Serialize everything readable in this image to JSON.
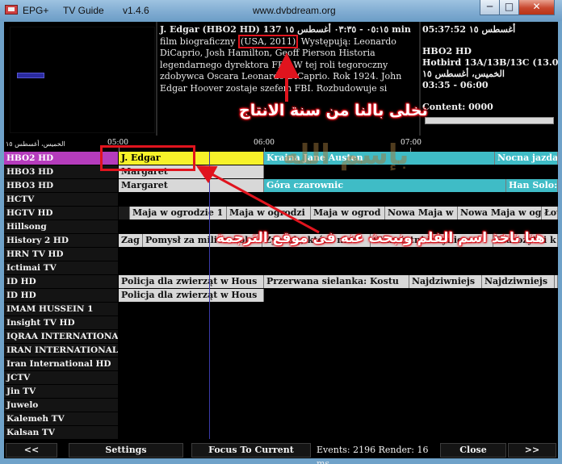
{
  "window": {
    "app_name": "EPG+",
    "menu": "TV Guide",
    "version": "v1.4.6",
    "site": "www.dvbdream.org",
    "buttons": {
      "minimize": "─",
      "maximize": "□",
      "close": "✕"
    }
  },
  "description": {
    "title_line": "J. Edgar  (HBO2 HD)  ٠٥:١٥ - ٠٣:٣٥  أغسطس ١٥  137 min",
    "year_text": "(USA, 2011)",
    "line1_pre": "film biograficzny ",
    "line1_post": " Występują: Leonardo",
    "body": "DiCaprio, Josh Hamilton, Geoff Pierson Historia legendarnego dyrektora FBI. W tej roli tegoroczny zdobywca Oscara Leonardo DiCaprio. Rok 1924. John Edgar Hoover zostaje szefem FBI. Rozbudowuje si"
  },
  "info": {
    "time": "05:37:52  أغسطس ١٥",
    "channel": "HBO2 HD",
    "satellite": "Hotbird 13A/13B/13C (13.0",
    "date": "الخميس، أغسطس ١٥",
    "range": "03:35 - 06:00",
    "content": "Content: 0000",
    "progress": 0
  },
  "ruler": {
    "day": "الخميس، أغسطس ١٥",
    "ticks": [
      "05:00",
      "06:00",
      "07:00"
    ]
  },
  "channels": [
    "HBO2 HD",
    "HBO3 HD",
    "HBO3 HD",
    "HCTV",
    "HGTV HD",
    "Hillsong",
    "History 2 HD",
    "HRN TV HD",
    "Ictimai TV",
    "ID HD",
    "ID HD",
    "IMAM HUSSEIN 1",
    "Insight TV HD",
    "IQRAA INTERNATIONAL",
    "IRAN INTERNATIONAL",
    "Iran International HD",
    "JCTV",
    "Jin TV",
    "Juwelo",
    "Kalemeh TV",
    "Kalsan TV"
  ],
  "programs": {
    "r0": [
      "J. Edgar",
      "Kraina Jane Austen",
      "Nocna jazda"
    ],
    "r1": [
      "Margaret"
    ],
    "r2": [
      "Margaret",
      "Góra czarownic",
      "Han Solo: "
    ],
    "r4": [
      "Maja w ogrodzie 1",
      "Maja w ogrodzi",
      "Maja w ogrod",
      "Nowa Maja w",
      "Nowa Maja w og",
      "Łow"
    ],
    "r6": [
      "Zag",
      "Pomysł za milion dola",
      "Żywioły, które nios",
      "Starożytni inżynierow",
      "Starożytni k"
    ],
    "r9": [
      "Policja dla zwierząt w Hous",
      "Przerwana sielanka: Kostu",
      "Najdziwniejs",
      "Najdziwniejs",
      "N"
    ],
    "r10": [
      "Policja dla zwierząt w Hous"
    ]
  },
  "bottom": {
    "prev": "<<",
    "settings": "Settings",
    "focus": "Focus To Current",
    "events": "Events: 2196  Render: 16 ms",
    "close": "Close",
    "next": ">>"
  },
  "annotations": {
    "year_note": "نخلى بالنا من سنة الانتاج",
    "title_note": "هنا ناخذ اسم الفلم ونبحث عنه فى موقع الترجمة",
    "watermark": "بإسم الله"
  },
  "colors": {
    "selected_channel": "#b53cbc",
    "current_program": "#f7f22a",
    "next_program": "#3fbcc6",
    "annotation": "#e0141e"
  }
}
